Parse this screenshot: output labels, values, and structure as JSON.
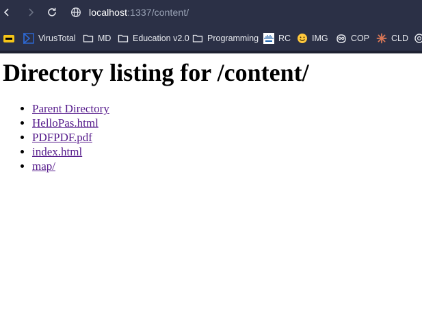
{
  "browser": {
    "url_host": "localhost",
    "url_path": ":1337/content/"
  },
  "bookmarks": [
    {
      "icon": "yellow-badge-icon",
      "label": ""
    },
    {
      "icon": "virustotal-icon",
      "label": "VirusTotal"
    },
    {
      "icon": "folder-icon",
      "label": "MD"
    },
    {
      "icon": "folder-icon",
      "label": "Education v2.0"
    },
    {
      "icon": "folder-icon",
      "label": "Programming"
    },
    {
      "icon": "cisco-icon",
      "label": "RC"
    },
    {
      "icon": "hugging-face-icon",
      "label": "IMG"
    },
    {
      "icon": "copilot-icon",
      "label": "COP"
    },
    {
      "icon": "claude-icon",
      "label": "CLD"
    },
    {
      "icon": "openai-icon",
      "label": ""
    }
  ],
  "page": {
    "heading": "Directory listing for /content/",
    "links": [
      "Parent Directory",
      "HelloPas.html",
      "PDFPDF.pdf",
      "index.html",
      "map/"
    ]
  }
}
